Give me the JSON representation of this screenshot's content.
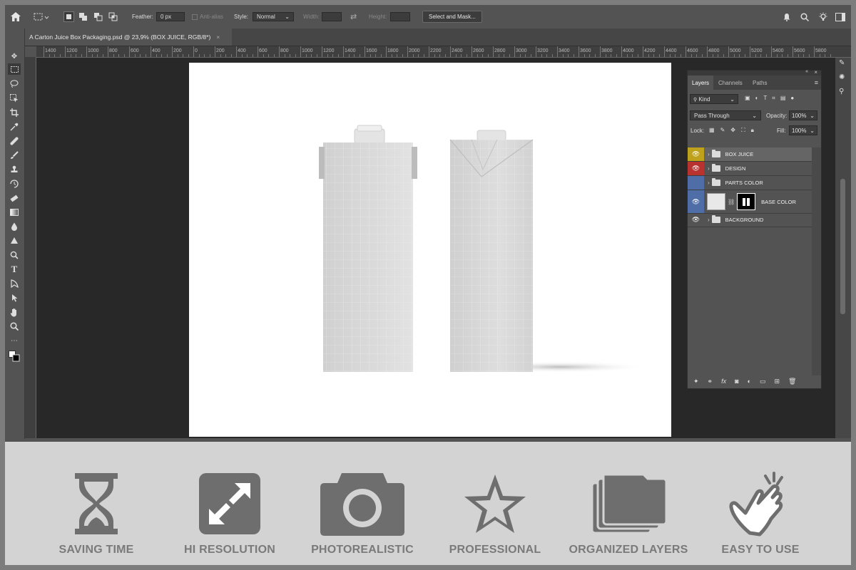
{
  "options_bar": {
    "feather_label": "Feather:",
    "feather_value": "0 px",
    "anti_alias_label": "Anti-alias",
    "style_label": "Style:",
    "style_value": "Normal",
    "width_label": "Width:",
    "height_label": "Height:",
    "select_mask_label": "Select and Mask..."
  },
  "document_tab": {
    "title": "A Carton Juice Box Packaging.psd @ 23,9% (BOX JUICE, RGB/8*)",
    "close": "×"
  },
  "ruler": {
    "ticks": [
      "1400",
      "1200",
      "1000",
      "800",
      "600",
      "400",
      "200",
      "0",
      "200",
      "400",
      "600",
      "800",
      "1000",
      "1200",
      "1400",
      "1600",
      "1800",
      "2000",
      "2200",
      "2400",
      "2600",
      "2800",
      "3000",
      "3200",
      "3400",
      "3600",
      "3800",
      "4000",
      "4200",
      "4400",
      "4600",
      "4800",
      "5000",
      "5200",
      "5400",
      "5600",
      "5800"
    ]
  },
  "layers_panel": {
    "tabs": [
      "Layers",
      "Channels",
      "Paths"
    ],
    "filter_kind": "Kind",
    "blend_mode": "Pass Through",
    "opacity_label": "Opacity:",
    "opacity_value": "100%",
    "lock_label": "Lock:",
    "fill_label": "Fill:",
    "fill_value": "100%",
    "layers": [
      {
        "name": "BOX JUICE",
        "color": "#bfa21c"
      },
      {
        "name": "DESIGN",
        "color": "#b8332f"
      },
      {
        "name": "PARTS COLOR",
        "color": "#4f6ea8"
      },
      {
        "name": "BASE COLOR",
        "color": "#4f6ea8"
      },
      {
        "name": "BACKGROUND",
        "color": "#535353"
      }
    ],
    "footer_fx": "fx"
  },
  "features": [
    {
      "label": "SAVING TIME",
      "icon": "hourglass-icon"
    },
    {
      "label": "HI RESOLUTION",
      "icon": "expand-arrows-icon"
    },
    {
      "label": "PHOTOREALISTIC",
      "icon": "camera-icon"
    },
    {
      "label": "PROFESSIONAL",
      "icon": "star-icon"
    },
    {
      "label": "ORGANIZED LAYERS",
      "icon": "stacked-folders-icon"
    },
    {
      "label": "EASY TO USE",
      "icon": "pointing-hand-icon"
    }
  ],
  "colors": {
    "workspace": "#535353",
    "canvas_bg": "#282828",
    "feature_bg": "#d3d3d3",
    "feature_icon": "#6e6e6e"
  }
}
